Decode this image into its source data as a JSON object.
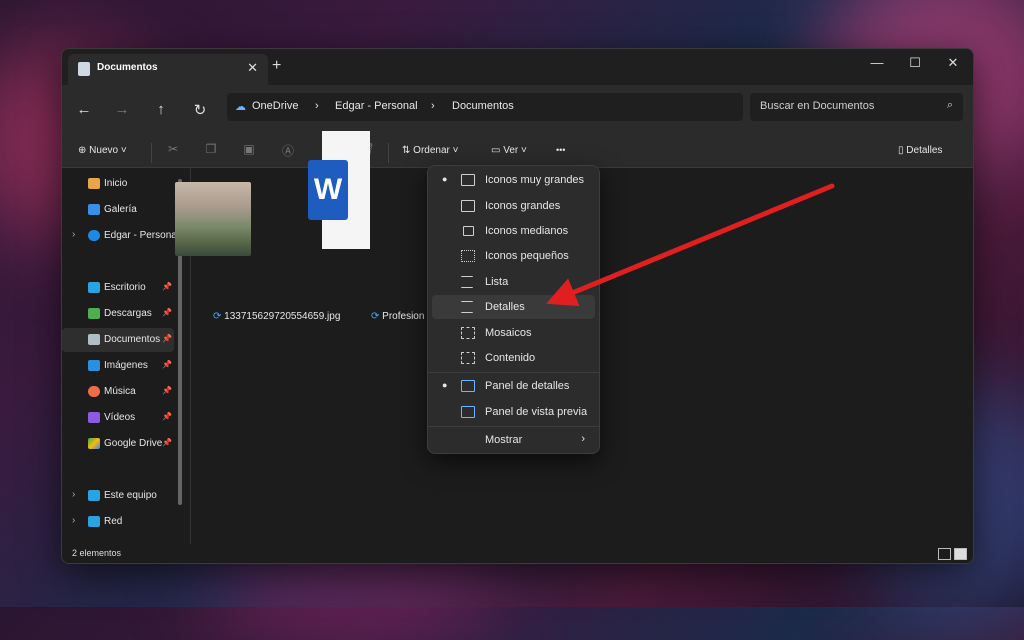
{
  "window": {
    "tab_title": "Documentos",
    "new_tab": "+",
    "minimize": "—",
    "maximize": "☐",
    "close": "✕"
  },
  "nav": {
    "back": "←",
    "forward": "→",
    "up": "↑",
    "refresh": "↻"
  },
  "breadcrumb": [
    "OneDrive",
    "Edgar - Personal",
    "Documentos"
  ],
  "search": {
    "placeholder": "Buscar en Documentos"
  },
  "toolbar": {
    "new_label": "Nuevo",
    "sort_label": "Ordenar",
    "view_label": "Ver",
    "more": "•••",
    "details_label": "Detalles"
  },
  "sidebar": {
    "items": [
      {
        "label": "Inicio",
        "color": "#e8a54a",
        "pinned": false
      },
      {
        "label": "Galería",
        "color": "#3a8ee6",
        "pinned": false
      },
      {
        "label": "Edgar - Personal",
        "color": "#1e88e5",
        "pinned": false
      },
      {
        "label": "Escritorio",
        "color": "#2ba3e0",
        "pinned": true
      },
      {
        "label": "Descargas",
        "color": "#4caf50",
        "pinned": true
      },
      {
        "label": "Documentos",
        "color": "#b0bec5",
        "pinned": true
      },
      {
        "label": "Imágenes",
        "color": "#2b8fe0",
        "pinned": true
      },
      {
        "label": "Música",
        "color": "#ef6c4a",
        "pinned": true
      },
      {
        "label": "Vídeos",
        "color": "#8e5ae0",
        "pinned": true
      },
      {
        "label": "Google Drive",
        "color": "#34a853",
        "pinned": true
      },
      {
        "label": "Este equipo",
        "color": "#2ba3e0",
        "pinned": false
      },
      {
        "label": "Red",
        "color": "#2ba3e0",
        "pinned": false
      }
    ]
  },
  "files": [
    {
      "name": "133715629720554659.jpg",
      "type": "image"
    },
    {
      "name": "Profesion",
      "type": "word"
    }
  ],
  "view_menu": {
    "items": [
      {
        "label": "Iconos muy grandes",
        "checked": true
      },
      {
        "label": "Iconos grandes",
        "checked": false
      },
      {
        "label": "Iconos medianos",
        "checked": false
      },
      {
        "label": "Iconos pequeños",
        "checked": false
      },
      {
        "label": "Lista",
        "checked": false
      },
      {
        "label": "Detalles",
        "checked": false
      },
      {
        "label": "Mosaicos",
        "checked": false
      },
      {
        "label": "Contenido",
        "checked": false
      },
      {
        "label": "Panel de detalles",
        "checked": true
      },
      {
        "label": "Panel de vista previa",
        "checked": false
      },
      {
        "label": "Mostrar",
        "checked": false
      }
    ]
  },
  "status": {
    "count": "2 elementos"
  },
  "colors": {
    "accent": "#e02020",
    "word_blue": "#1e5cbf"
  }
}
